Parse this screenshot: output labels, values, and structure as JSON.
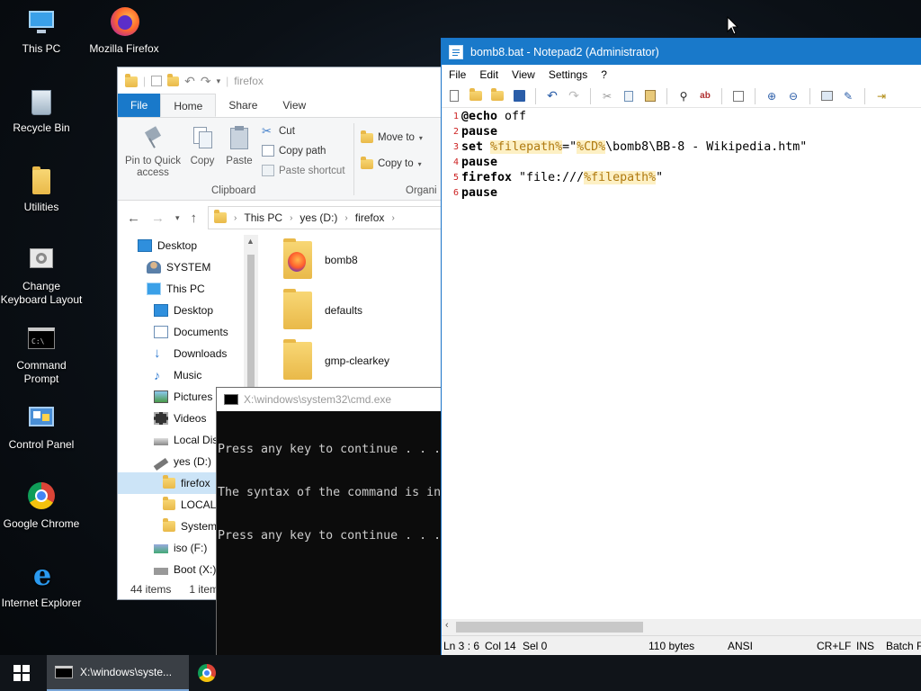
{
  "desktop": {
    "icons": [
      {
        "label": "This PC"
      },
      {
        "label": "Mozilla Firefox"
      },
      {
        "label": "Recycle Bin"
      },
      {
        "label": "Utilities"
      },
      {
        "label": "Change Keyboard Layout"
      },
      {
        "label": "Command Prompt"
      },
      {
        "label": "Control Panel"
      },
      {
        "label": "Google Chrome"
      },
      {
        "label": "Internet Explorer"
      }
    ]
  },
  "explorer": {
    "title": "firefox",
    "tabs": {
      "file": "File",
      "home": "Home",
      "share": "Share",
      "view": "View"
    },
    "ribbon": {
      "pin": "Pin to Quick access",
      "copy": "Copy",
      "paste": "Paste",
      "cut": "Cut",
      "copy_path": "Copy path",
      "paste_shortcut": "Paste shortcut",
      "clipboard_group": "Clipboard",
      "move_to": "Move to",
      "copy_to": "Copy to",
      "organize_group": "Organi"
    },
    "address": {
      "crumbs": [
        "This PC",
        "yes (D:)",
        "firefox"
      ]
    },
    "nav": [
      {
        "label": "Desktop"
      },
      {
        "label": "SYSTEM"
      },
      {
        "label": "This PC"
      },
      {
        "label": "Desktop"
      },
      {
        "label": "Documents"
      },
      {
        "label": "Downloads"
      },
      {
        "label": "Music"
      },
      {
        "label": "Pictures"
      },
      {
        "label": "Videos"
      },
      {
        "label": "Local Disk"
      },
      {
        "label": "yes (D:)"
      },
      {
        "label": "firefox"
      },
      {
        "label": "LOCALE"
      },
      {
        "label": "System"
      },
      {
        "label": "iso (F:)"
      },
      {
        "label": "Boot (X:)"
      }
    ],
    "files": [
      {
        "name": "bomb8"
      },
      {
        "name": "defaults"
      },
      {
        "name": "gmp-clearkey"
      }
    ],
    "status": {
      "count": "44 items",
      "selected": "1 item"
    }
  },
  "cmd": {
    "title": "X:\\windows\\system32\\cmd.exe",
    "lines": [
      "Press any key to continue . . .",
      "The syntax of the command is in",
      "Press any key to continue . . ."
    ]
  },
  "notepad": {
    "title": "bomb8.bat - Notepad2 (Administrator)",
    "menu": [
      "File",
      "Edit",
      "View",
      "Settings",
      "?"
    ],
    "line_numbers": [
      "1",
      "2",
      "3",
      "4",
      "5",
      "6"
    ],
    "code": {
      "l1_kw": "@echo",
      "l1_rest": " off",
      "l2_kw": "pause",
      "l3_kw": "set",
      "l3_sp": " ",
      "l3_var1": "%filepath%",
      "l3_eq": "=\"",
      "l3_var2": "%CD%",
      "l3_rest": "\\bomb8\\BB-8 - Wikipedia.htm\"",
      "l4_kw": "pause",
      "l5_kw": "firefox",
      "l5_str": " \"file:///",
      "l5_var": "%filepath%",
      "l5_end": "\"",
      "l6_kw": "pause"
    },
    "status": {
      "position": "Ln 3 : 6",
      "col": "Col 14",
      "sel": "Sel 0",
      "size": "110 bytes",
      "encoding": "ANSI",
      "eol": "CR+LF",
      "mode": "INS",
      "lexer": "Batch F"
    }
  },
  "taskbar": {
    "cmd_label": "X:\\windows\\syste..."
  },
  "colors": {
    "accent": "#1979ca",
    "folder": "#f8d775",
    "line_number": "#cc2020",
    "variable_bg": "#fdf0c4",
    "variable_fg": "#b07a10"
  }
}
